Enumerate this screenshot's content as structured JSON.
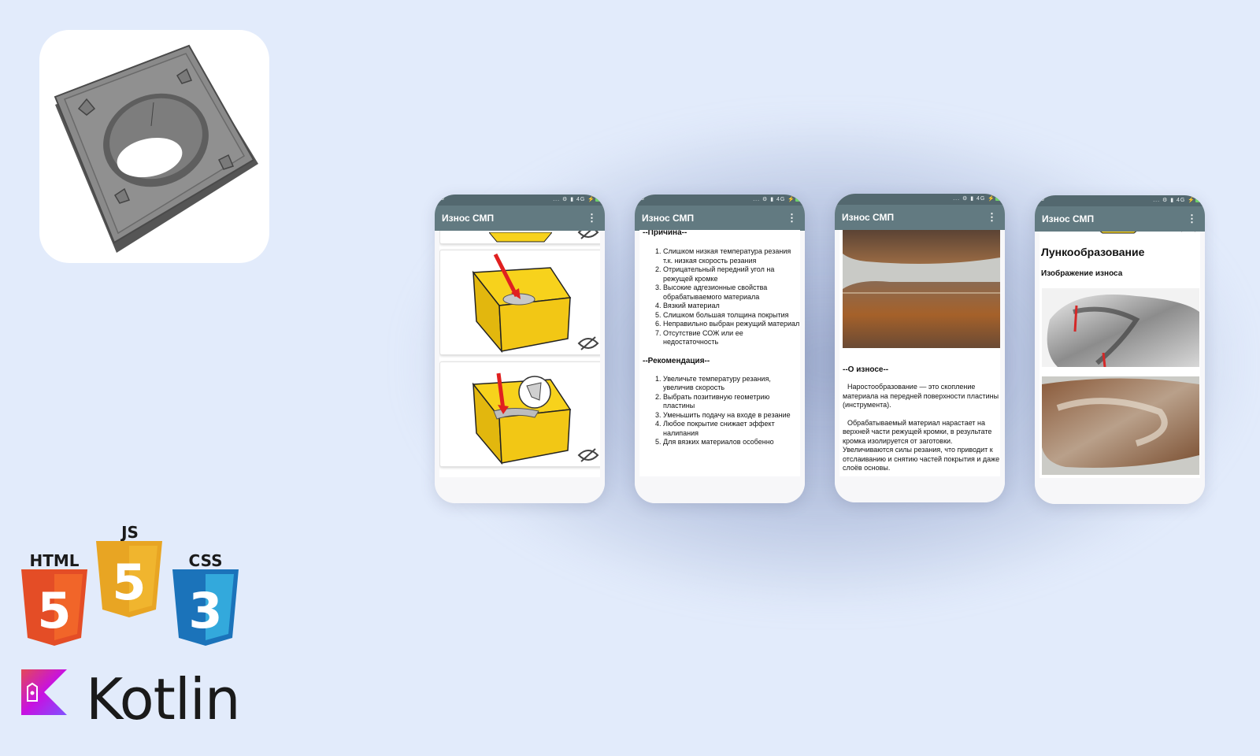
{
  "app": {
    "title": "Износ СМП",
    "menu_glyph": "⋮",
    "icon": "carbide-insert-icon"
  },
  "status_bar": {
    "times": [
      "5",
      "8",
      "",
      "5"
    ],
    "icons_text": "... ⚙ ▮ 4G ⚡"
  },
  "screen2": {
    "cause_title": "--Причина--",
    "causes": [
      "Слишком низкая температура резания т.к. низкая скорость резания",
      "Отрицательный передний угол на режущей кромке",
      "Высокие адгезионные свойства обрабатываемого материала",
      "Вязкий материал",
      "Слишком большая толщина покрытия",
      "Неправильно выбран режущий материал",
      "Отсутствие СОЖ или ее недостаточность"
    ],
    "rec_title": "--Рекомендация--",
    "recommendations": [
      "Увеличьте температуру резания, увеличив скорость",
      "Выбрать позитивную геометрию пластины",
      "Уменьшить подачу на входе в резание",
      "Любое покрытие снижает эффект налипания",
      "Для вязких материалов особенно"
    ]
  },
  "screen3": {
    "about_title": "--О износе--",
    "para1": "Наростообразование — это скопление материала на передней поверхности пластины (инструмента).",
    "para2": "Обрабатываемый материал нарастает на верхней части режущей кромки, в результате кромка изолируется от заготовки. Увеличиваются силы резания, что приводит к отслаиванию и снятию частей покрытия и даже слоёв основы."
  },
  "screen4": {
    "heading": "Лункообразование",
    "subheading": "Изображение износа"
  },
  "tech": {
    "html_label": "HTML",
    "js_label": "JS",
    "css_label": "CSS",
    "html_digit": "5",
    "js_digit": "5",
    "css_digit": "3",
    "kotlin_label": "Kotlin",
    "colors": {
      "html": "#e44d26",
      "js": "#e8a523",
      "css": "#1b73ba",
      "kotlin_a": "#7f52ff",
      "kotlin_b": "#e44857"
    }
  },
  "colors": {
    "background": "#e2ebfb",
    "toolbar": "#627a81",
    "statusbar": "#53686f",
    "insert_yellow": "#f7d21c"
  }
}
